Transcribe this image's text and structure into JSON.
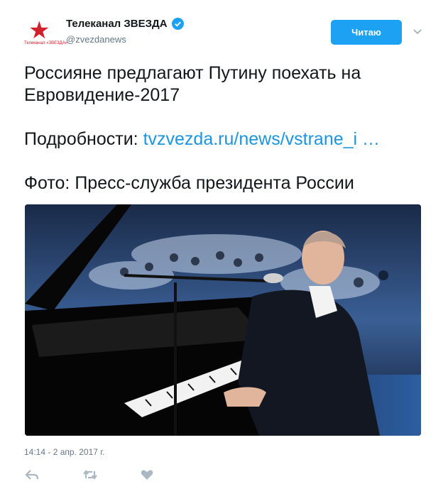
{
  "account": {
    "display_name": "Телеканал ЗВЕЗДА",
    "handle": "@zvezdanews",
    "verified_icon": "verified-badge-icon",
    "avatar_logo_text": "Телеканал «ЗВЕЗДА»"
  },
  "follow_button": {
    "label": "Читаю"
  },
  "tweet": {
    "line1": "Россияне предлагают Путину поехать на Евровидение-2017",
    "details_label": "Подробности: ",
    "details_link": "tvzvezda.ru/news/vstrane_i …",
    "photo_credit": "Фото: Пресс-служба президента России",
    "timestamp": "14:14 - 2 апр. 2017 г."
  },
  "actions": [
    "reply-icon",
    "retweet-icon",
    "like-icon"
  ],
  "colors": {
    "accent": "#1da1f2",
    "link": "#1b95e0",
    "muted": "#657786",
    "brand_red": "#d0202a"
  }
}
